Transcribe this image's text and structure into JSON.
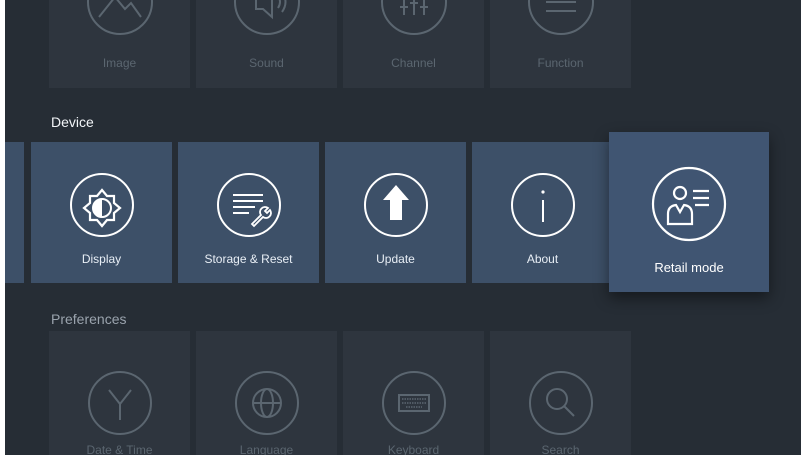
{
  "top_row": [
    {
      "label": "Image",
      "icon": "image-icon"
    },
    {
      "label": "Sound",
      "icon": "speaker-icon"
    },
    {
      "label": "Channel",
      "icon": "channel-icon"
    },
    {
      "label": "Function",
      "icon": "menu-lines-icon"
    }
  ],
  "device": {
    "title": "Device",
    "items": [
      {
        "label": "Display",
        "icon": "brightness-icon"
      },
      {
        "label": "Storage & Reset",
        "icon": "storage-wrench-icon"
      },
      {
        "label": "Update",
        "icon": "arrow-up-icon"
      },
      {
        "label": "About",
        "icon": "info-icon"
      },
      {
        "label": "Retail mode",
        "icon": "retail-person-icon"
      }
    ]
  },
  "preferences": {
    "title": "Preferences",
    "items": [
      {
        "label": "Date & Time",
        "icon": "clock-icon"
      },
      {
        "label": "Language",
        "icon": "globe-icon"
      },
      {
        "label": "Keyboard",
        "icon": "keyboard-icon"
      },
      {
        "label": "Search",
        "icon": "search-icon"
      }
    ]
  },
  "colors": {
    "background": "#262d35",
    "tile_dim": "#2e353e",
    "tile_active": "#3d5068",
    "tile_focus": "#405572"
  }
}
